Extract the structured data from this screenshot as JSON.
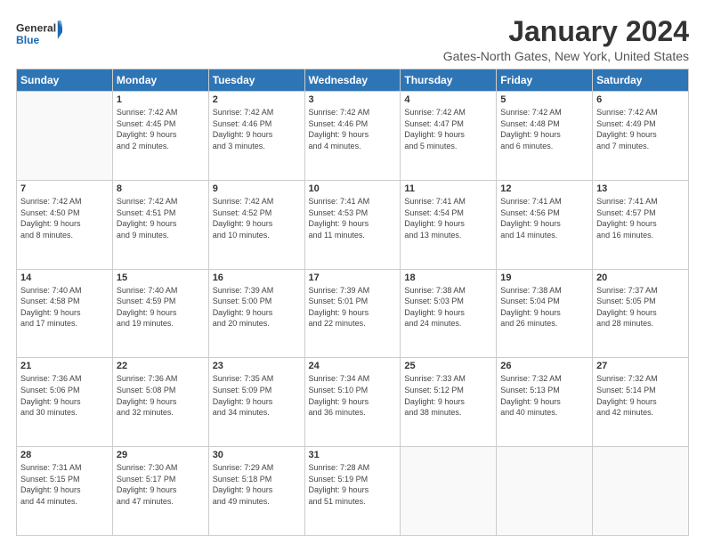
{
  "logo": {
    "text_general": "General",
    "text_blue": "Blue"
  },
  "header": {
    "title": "January 2024",
    "subtitle": "Gates-North Gates, New York, United States"
  },
  "weekdays": [
    "Sunday",
    "Monday",
    "Tuesday",
    "Wednesday",
    "Thursday",
    "Friday",
    "Saturday"
  ],
  "weeks": [
    [
      {
        "day": "",
        "info": ""
      },
      {
        "day": "1",
        "info": "Sunrise: 7:42 AM\nSunset: 4:45 PM\nDaylight: 9 hours\nand 2 minutes."
      },
      {
        "day": "2",
        "info": "Sunrise: 7:42 AM\nSunset: 4:46 PM\nDaylight: 9 hours\nand 3 minutes."
      },
      {
        "day": "3",
        "info": "Sunrise: 7:42 AM\nSunset: 4:46 PM\nDaylight: 9 hours\nand 4 minutes."
      },
      {
        "day": "4",
        "info": "Sunrise: 7:42 AM\nSunset: 4:47 PM\nDaylight: 9 hours\nand 5 minutes."
      },
      {
        "day": "5",
        "info": "Sunrise: 7:42 AM\nSunset: 4:48 PM\nDaylight: 9 hours\nand 6 minutes."
      },
      {
        "day": "6",
        "info": "Sunrise: 7:42 AM\nSunset: 4:49 PM\nDaylight: 9 hours\nand 7 minutes."
      }
    ],
    [
      {
        "day": "7",
        "info": "Sunrise: 7:42 AM\nSunset: 4:50 PM\nDaylight: 9 hours\nand 8 minutes."
      },
      {
        "day": "8",
        "info": "Sunrise: 7:42 AM\nSunset: 4:51 PM\nDaylight: 9 hours\nand 9 minutes."
      },
      {
        "day": "9",
        "info": "Sunrise: 7:42 AM\nSunset: 4:52 PM\nDaylight: 9 hours\nand 10 minutes."
      },
      {
        "day": "10",
        "info": "Sunrise: 7:41 AM\nSunset: 4:53 PM\nDaylight: 9 hours\nand 11 minutes."
      },
      {
        "day": "11",
        "info": "Sunrise: 7:41 AM\nSunset: 4:54 PM\nDaylight: 9 hours\nand 13 minutes."
      },
      {
        "day": "12",
        "info": "Sunrise: 7:41 AM\nSunset: 4:56 PM\nDaylight: 9 hours\nand 14 minutes."
      },
      {
        "day": "13",
        "info": "Sunrise: 7:41 AM\nSunset: 4:57 PM\nDaylight: 9 hours\nand 16 minutes."
      }
    ],
    [
      {
        "day": "14",
        "info": "Sunrise: 7:40 AM\nSunset: 4:58 PM\nDaylight: 9 hours\nand 17 minutes."
      },
      {
        "day": "15",
        "info": "Sunrise: 7:40 AM\nSunset: 4:59 PM\nDaylight: 9 hours\nand 19 minutes."
      },
      {
        "day": "16",
        "info": "Sunrise: 7:39 AM\nSunset: 5:00 PM\nDaylight: 9 hours\nand 20 minutes."
      },
      {
        "day": "17",
        "info": "Sunrise: 7:39 AM\nSunset: 5:01 PM\nDaylight: 9 hours\nand 22 minutes."
      },
      {
        "day": "18",
        "info": "Sunrise: 7:38 AM\nSunset: 5:03 PM\nDaylight: 9 hours\nand 24 minutes."
      },
      {
        "day": "19",
        "info": "Sunrise: 7:38 AM\nSunset: 5:04 PM\nDaylight: 9 hours\nand 26 minutes."
      },
      {
        "day": "20",
        "info": "Sunrise: 7:37 AM\nSunset: 5:05 PM\nDaylight: 9 hours\nand 28 minutes."
      }
    ],
    [
      {
        "day": "21",
        "info": "Sunrise: 7:36 AM\nSunset: 5:06 PM\nDaylight: 9 hours\nand 30 minutes."
      },
      {
        "day": "22",
        "info": "Sunrise: 7:36 AM\nSunset: 5:08 PM\nDaylight: 9 hours\nand 32 minutes."
      },
      {
        "day": "23",
        "info": "Sunrise: 7:35 AM\nSunset: 5:09 PM\nDaylight: 9 hours\nand 34 minutes."
      },
      {
        "day": "24",
        "info": "Sunrise: 7:34 AM\nSunset: 5:10 PM\nDaylight: 9 hours\nand 36 minutes."
      },
      {
        "day": "25",
        "info": "Sunrise: 7:33 AM\nSunset: 5:12 PM\nDaylight: 9 hours\nand 38 minutes."
      },
      {
        "day": "26",
        "info": "Sunrise: 7:32 AM\nSunset: 5:13 PM\nDaylight: 9 hours\nand 40 minutes."
      },
      {
        "day": "27",
        "info": "Sunrise: 7:32 AM\nSunset: 5:14 PM\nDaylight: 9 hours\nand 42 minutes."
      }
    ],
    [
      {
        "day": "28",
        "info": "Sunrise: 7:31 AM\nSunset: 5:15 PM\nDaylight: 9 hours\nand 44 minutes."
      },
      {
        "day": "29",
        "info": "Sunrise: 7:30 AM\nSunset: 5:17 PM\nDaylight: 9 hours\nand 47 minutes."
      },
      {
        "day": "30",
        "info": "Sunrise: 7:29 AM\nSunset: 5:18 PM\nDaylight: 9 hours\nand 49 minutes."
      },
      {
        "day": "31",
        "info": "Sunrise: 7:28 AM\nSunset: 5:19 PM\nDaylight: 9 hours\nand 51 minutes."
      },
      {
        "day": "",
        "info": ""
      },
      {
        "day": "",
        "info": ""
      },
      {
        "day": "",
        "info": ""
      }
    ]
  ]
}
